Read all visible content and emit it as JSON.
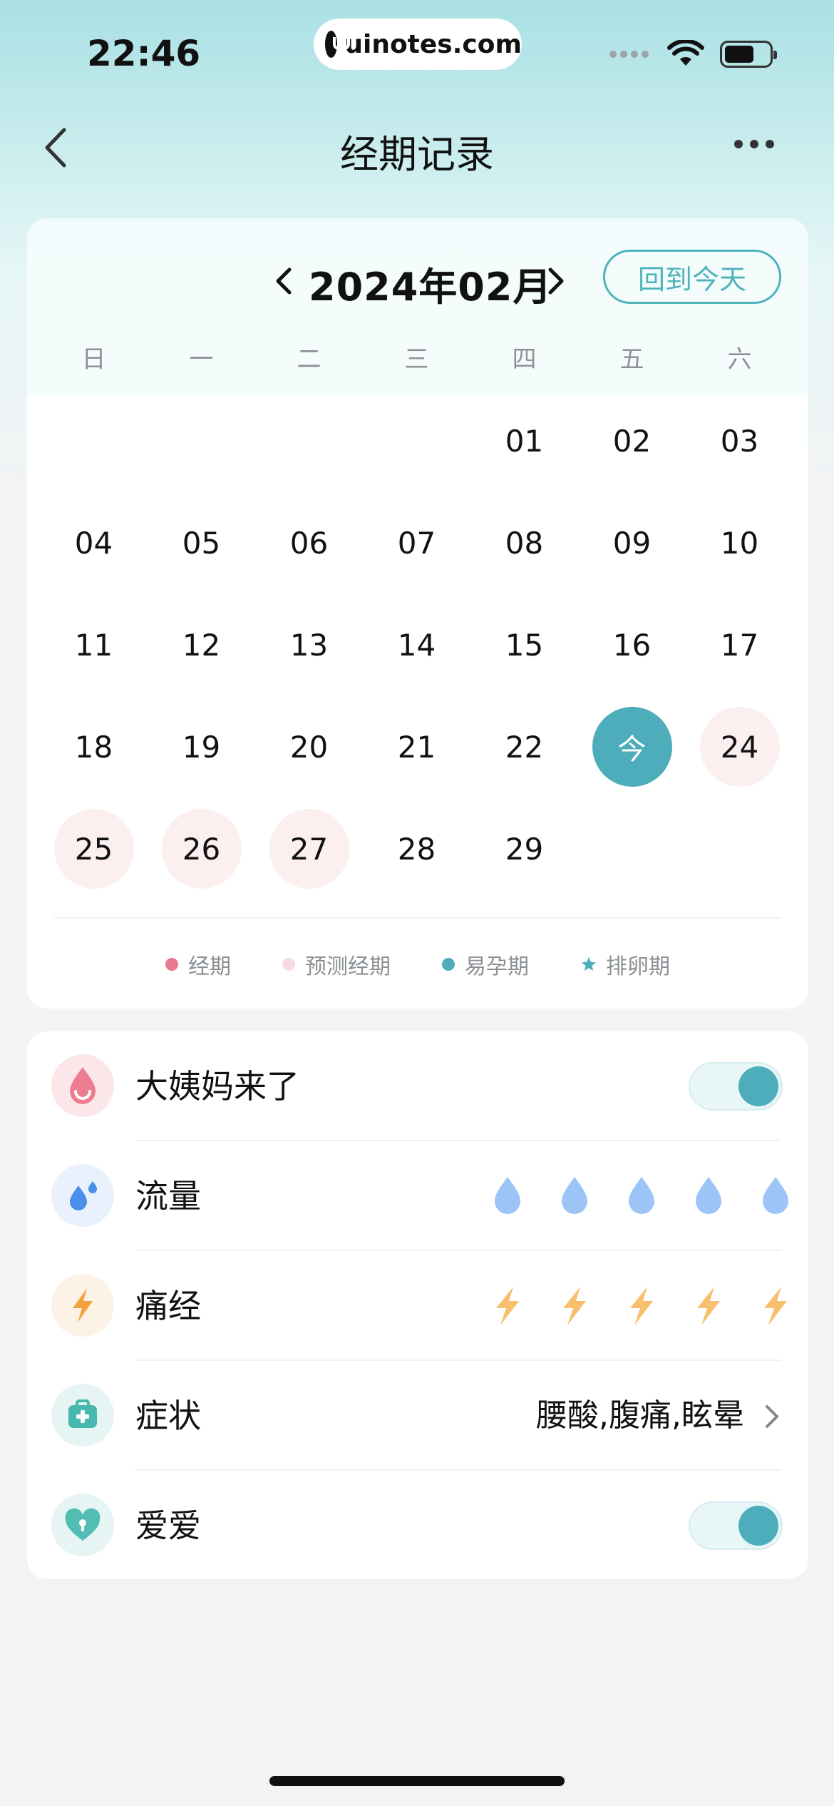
{
  "status_bar": {
    "time": "22:46",
    "watermark": "uinotes.com"
  },
  "nav": {
    "title": "经期记录"
  },
  "calendar": {
    "month_label": "2024年02月",
    "today_button": "回到今天",
    "weekdays": [
      "日",
      "一",
      "二",
      "三",
      "四",
      "五",
      "六"
    ],
    "first_weekday_index": 4,
    "days": [
      {
        "label": "01",
        "state": "normal"
      },
      {
        "label": "02",
        "state": "normal"
      },
      {
        "label": "03",
        "state": "normal"
      },
      {
        "label": "04",
        "state": "normal"
      },
      {
        "label": "05",
        "state": "normal"
      },
      {
        "label": "06",
        "state": "normal"
      },
      {
        "label": "07",
        "state": "normal"
      },
      {
        "label": "08",
        "state": "normal"
      },
      {
        "label": "09",
        "state": "normal"
      },
      {
        "label": "10",
        "state": "normal"
      },
      {
        "label": "11",
        "state": "normal"
      },
      {
        "label": "12",
        "state": "normal"
      },
      {
        "label": "13",
        "state": "normal"
      },
      {
        "label": "14",
        "state": "normal"
      },
      {
        "label": "15",
        "state": "normal"
      },
      {
        "label": "16",
        "state": "normal"
      },
      {
        "label": "17",
        "state": "normal"
      },
      {
        "label": "18",
        "state": "normal"
      },
      {
        "label": "19",
        "state": "normal"
      },
      {
        "label": "20",
        "state": "normal"
      },
      {
        "label": "21",
        "state": "normal"
      },
      {
        "label": "22",
        "state": "normal"
      },
      {
        "label": "今",
        "state": "today"
      },
      {
        "label": "24",
        "state": "period"
      },
      {
        "label": "25",
        "state": "period"
      },
      {
        "label": "26",
        "state": "period"
      },
      {
        "label": "27",
        "state": "period"
      },
      {
        "label": "28",
        "state": "normal"
      },
      {
        "label": "29",
        "state": "normal"
      }
    ],
    "legend": [
      {
        "label": "经期",
        "color": "#e7798a",
        "shape": "dot"
      },
      {
        "label": "预测经期",
        "color": "#f7d9de",
        "shape": "dot"
      },
      {
        "label": "易孕期",
        "color": "#4eadbb",
        "shape": "dot"
      },
      {
        "label": "排卵期",
        "color": "#4eadbb",
        "shape": "star-icon"
      }
    ]
  },
  "records": {
    "period_started": {
      "label": "大姨妈来了",
      "icon": "blood-drop-icon",
      "on": true
    },
    "flow": {
      "label": "流量",
      "icon": "water-drops-icon",
      "level": 0,
      "max": 5
    },
    "cramps": {
      "label": "痛经",
      "icon": "lightning-icon",
      "level": 0,
      "max": 5
    },
    "symptoms": {
      "label": "症状",
      "icon": "medical-kit-icon",
      "value": "腰酸,腹痛,眩晕"
    },
    "intimacy": {
      "label": "爱爱",
      "icon": "heart-lock-icon",
      "on": true
    }
  },
  "colors": {
    "accent": "#4eadbb",
    "period": "#fbeff0",
    "flow": "#8ab8f5",
    "cramp": "#f5b860"
  }
}
